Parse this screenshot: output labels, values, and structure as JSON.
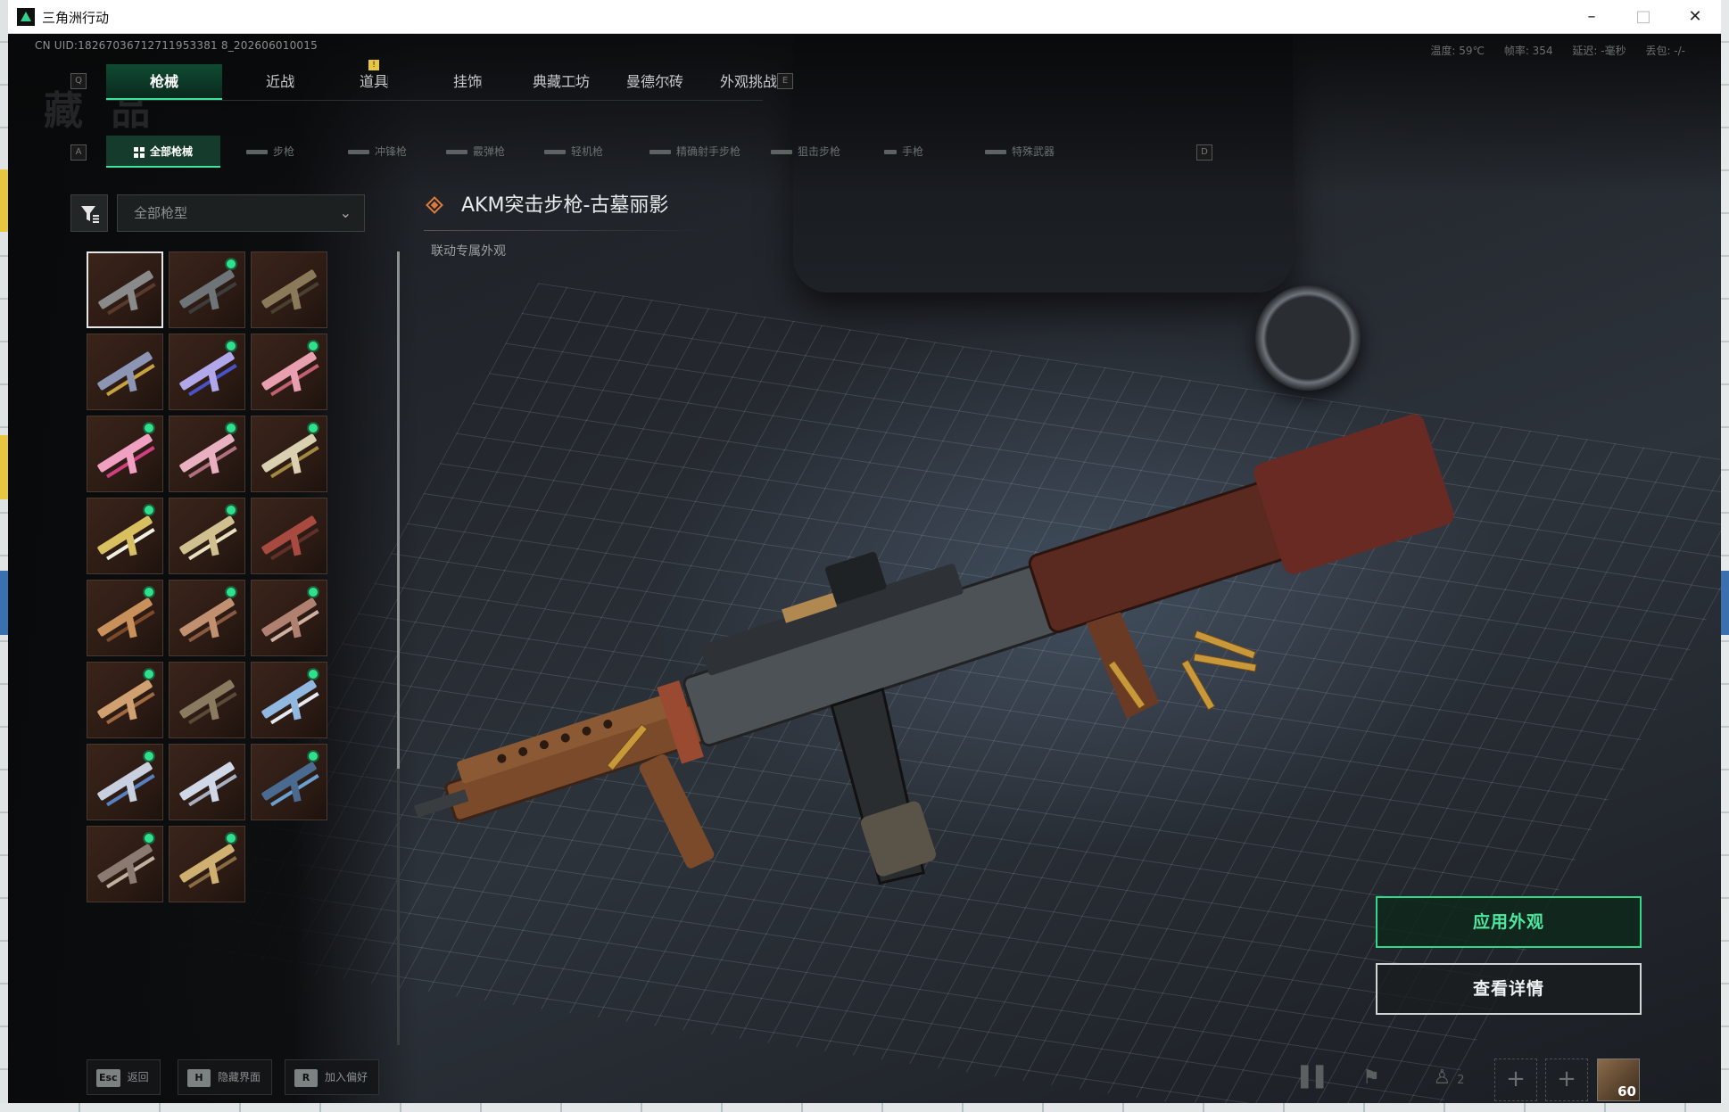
{
  "window": {
    "title": "三角洲行动"
  },
  "header": {
    "uid": "CN UID:18267036712711953381 8_202606010015",
    "status": {
      "temp": "温度: 59℃",
      "fps": "帧率: 354",
      "latency": "延迟: -毫秒",
      "loss": "丢包: -/-"
    },
    "watermark": "藏 品"
  },
  "category_tabs": {
    "prev_key": "Q",
    "next_key": "E",
    "items": [
      {
        "label": "枪械",
        "active": true
      },
      {
        "label": "近战"
      },
      {
        "label": "道具",
        "badge": "!"
      },
      {
        "label": "挂饰"
      },
      {
        "label": "典藏工坊"
      },
      {
        "label": "曼德尔砖"
      },
      {
        "label": "外观挑战"
      }
    ]
  },
  "sub_tabs": {
    "prev_key": "A",
    "next_key": "D",
    "items": [
      {
        "label": "全部枪械",
        "active": true
      },
      {
        "label": "步枪"
      },
      {
        "label": "冲锋枪"
      },
      {
        "label": "霰弹枪"
      },
      {
        "label": "轻机枪"
      },
      {
        "label": "精确射手步枪"
      },
      {
        "label": "狙击步枪"
      },
      {
        "label": "手枪"
      },
      {
        "label": "特殊武器"
      }
    ]
  },
  "filter": {
    "select_value": "全部枪型"
  },
  "item": {
    "name": "AKM突击步枪-古墓丽影",
    "tag": "联动专属外观"
  },
  "skins": [
    {
      "new": false,
      "selected": true,
      "color": "#8a8a8a",
      "color2": "#5a3a2a"
    },
    {
      "new": true,
      "color": "#6f7478",
      "color2": "#3d3d3d"
    },
    {
      "new": false,
      "color": "#8b7a5a",
      "color2": "#4a4030"
    },
    {
      "new": false,
      "color": "#8c96b4",
      "color2": "#c7a040"
    },
    {
      "new": true,
      "color": "#b0a8e8",
      "color2": "#4a52c8"
    },
    {
      "new": true,
      "color": "#e8a0b0",
      "color2": "#c06070"
    },
    {
      "new": true,
      "color": "#f0a0c0",
      "color2": "#d04080"
    },
    {
      "new": true,
      "color": "#e8b0c0",
      "color2": "#b07080"
    },
    {
      "new": true,
      "color": "#d8d0b0",
      "color2": "#a08840"
    },
    {
      "new": true,
      "color": "#d8c060",
      "color2": "#f0f0e0"
    },
    {
      "new": true,
      "color": "#d0c090",
      "color2": "#e8e0c0"
    },
    {
      "new": false,
      "color": "#a84a40",
      "color2": "#603028"
    },
    {
      "new": true,
      "color": "#c8905a",
      "color2": "#7a4a2a"
    },
    {
      "new": true,
      "color": "#c09070",
      "color2": "#8a5a40"
    },
    {
      "new": true,
      "color": "#b08070",
      "color2": "#d0b0a0"
    },
    {
      "new": true,
      "color": "#d0a070",
      "color2": "#a06a40"
    },
    {
      "new": false,
      "color": "#8a7a60",
      "color2": "#5a4a38"
    },
    {
      "new": true,
      "color": "#90b8e0",
      "color2": "#e8e8f0"
    },
    {
      "new": true,
      "color": "#c8d0e0",
      "color2": "#5880c0"
    },
    {
      "new": false,
      "color": "#d0d8e8",
      "color2": "#a8b0c0"
    },
    {
      "new": true,
      "color": "#4a6a90",
      "color2": "#6aa0d0"
    },
    {
      "new": true,
      "color": "#8a7a70",
      "color2": "#c0b0a0"
    },
    {
      "new": true,
      "color": "#d0b070",
      "color2": "#8a6a40"
    }
  ],
  "buttons": {
    "apply": "应用外观",
    "details": "查看详情"
  },
  "bottom_hints": [
    {
      "key": "Esc",
      "label": "返回"
    },
    {
      "key": "H",
      "label": "隐藏界面"
    },
    {
      "key": "R",
      "label": "加入偏好"
    }
  ],
  "bottom_right": {
    "party_count": "2",
    "level": "60",
    "add_label": "+"
  },
  "colors": {
    "accent": "#3be79c",
    "accent_dark": "#0f4a32",
    "new_dot": "#2fe08c"
  }
}
